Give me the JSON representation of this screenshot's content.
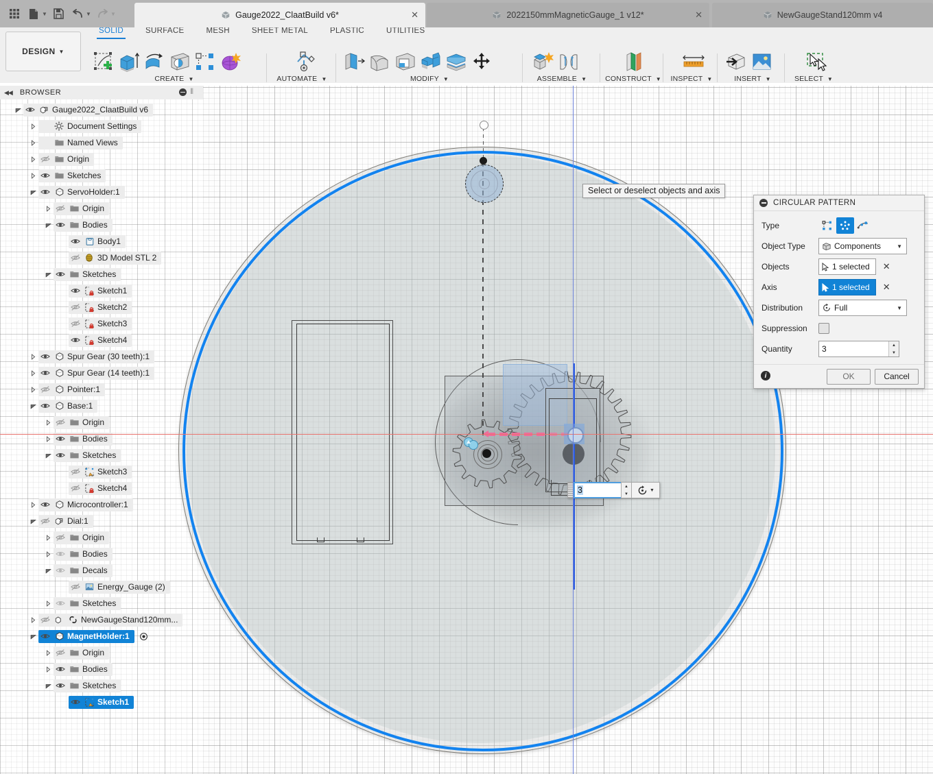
{
  "app": {
    "quick_access": [
      {
        "name": "apps-grid-icon",
        "label": "Apps"
      },
      {
        "name": "new-file-icon",
        "label": "New"
      },
      {
        "name": "save-icon",
        "label": "Save"
      },
      {
        "name": "undo-icon",
        "label": "Undo"
      },
      {
        "name": "redo-icon",
        "label": "Redo"
      }
    ]
  },
  "tabs": [
    {
      "label": "Gauge2022_ClaatBuild v6*",
      "active": true,
      "closable": true
    },
    {
      "label": "2022150mmMagneticGauge_1 v12*",
      "active": false,
      "closable": true
    },
    {
      "label": "NewGaugeStand120mm v4",
      "active": false,
      "closable": false
    }
  ],
  "ribbon": {
    "workspace": "DESIGN",
    "tabs": [
      {
        "label": "SOLID",
        "selected": true
      },
      {
        "label": "SURFACE",
        "selected": false
      },
      {
        "label": "MESH",
        "selected": false
      },
      {
        "label": "SHEET METAL",
        "selected": false
      },
      {
        "label": "PLASTIC",
        "selected": false
      },
      {
        "label": "UTILITIES",
        "selected": false
      }
    ],
    "groups": [
      {
        "label": "CREATE"
      },
      {
        "label": "AUTOMATE"
      },
      {
        "label": "MODIFY"
      },
      {
        "label": "ASSEMBLE"
      },
      {
        "label": "CONSTRUCT"
      },
      {
        "label": "INSPECT"
      },
      {
        "label": "INSERT"
      },
      {
        "label": "SELECT"
      }
    ]
  },
  "browser": {
    "title": "BROWSER",
    "tree": [
      {
        "label": "Gauge2022_ClaatBuild v6",
        "indent": 0,
        "arrow": "down",
        "eye": "on",
        "icon": "component-icon"
      },
      {
        "label": "Document Settings",
        "indent": 1,
        "arrow": "right",
        "eye": "none",
        "icon": "gear-icon"
      },
      {
        "label": "Named Views",
        "indent": 1,
        "arrow": "right",
        "eye": "none",
        "icon": "folder-icon"
      },
      {
        "label": "Origin",
        "indent": 1,
        "arrow": "right",
        "eye": "off",
        "icon": "folder-icon"
      },
      {
        "label": "Sketches",
        "indent": 1,
        "arrow": "right",
        "eye": "on",
        "icon": "folder-icon"
      },
      {
        "label": "ServoHolder:1",
        "indent": 1,
        "arrow": "down",
        "eye": "on",
        "icon": "body-icon"
      },
      {
        "label": "Origin",
        "indent": 2,
        "arrow": "right",
        "eye": "off",
        "icon": "folder-icon"
      },
      {
        "label": "Bodies",
        "indent": 2,
        "arrow": "down",
        "eye": "on",
        "icon": "folder-icon"
      },
      {
        "label": "Body1",
        "indent": 3,
        "arrow": "none",
        "eye": "on",
        "icon": "solid-body-icon"
      },
      {
        "label": "3D Model STL 2",
        "indent": 3,
        "arrow": "none",
        "eye": "off",
        "icon": "mesh-body-icon"
      },
      {
        "label": "Sketches",
        "indent": 2,
        "arrow": "down",
        "eye": "on",
        "icon": "folder-icon"
      },
      {
        "label": "Sketch1",
        "indent": 3,
        "arrow": "none",
        "eye": "on",
        "icon": "sketch-locked-icon"
      },
      {
        "label": "Sketch2",
        "indent": 3,
        "arrow": "none",
        "eye": "off",
        "icon": "sketch-locked-icon"
      },
      {
        "label": "Sketch3",
        "indent": 3,
        "arrow": "none",
        "eye": "off",
        "icon": "sketch-locked-icon"
      },
      {
        "label": "Sketch4",
        "indent": 3,
        "arrow": "none",
        "eye": "on",
        "icon": "sketch-locked-icon"
      },
      {
        "label": "Spur Gear (30 teeth):1",
        "indent": 1,
        "arrow": "right",
        "eye": "on",
        "icon": "body-icon"
      },
      {
        "label": "Spur Gear (14 teeth):1",
        "indent": 1,
        "arrow": "right",
        "eye": "on",
        "icon": "body-icon"
      },
      {
        "label": "Pointer:1",
        "indent": 1,
        "arrow": "right",
        "eye": "off",
        "icon": "body-icon"
      },
      {
        "label": "Base:1",
        "indent": 1,
        "arrow": "down",
        "eye": "on",
        "icon": "body-icon"
      },
      {
        "label": "Origin",
        "indent": 2,
        "arrow": "right",
        "eye": "off",
        "icon": "folder-icon"
      },
      {
        "label": "Bodies",
        "indent": 2,
        "arrow": "right",
        "eye": "on",
        "icon": "folder-icon"
      },
      {
        "label": "Sketches",
        "indent": 2,
        "arrow": "down",
        "eye": "on",
        "icon": "folder-icon"
      },
      {
        "label": "Sketch3",
        "indent": 3,
        "arrow": "none",
        "eye": "off",
        "icon": "sketch-edit-icon"
      },
      {
        "label": "Sketch4",
        "indent": 3,
        "arrow": "none",
        "eye": "off",
        "icon": "sketch-locked-icon"
      },
      {
        "label": "Microcontroller:1",
        "indent": 1,
        "arrow": "right",
        "eye": "on",
        "icon": "body-icon"
      },
      {
        "label": "Dial:1",
        "indent": 1,
        "arrow": "down",
        "eye": "off",
        "icon": "component-icon"
      },
      {
        "label": "Origin",
        "indent": 2,
        "arrow": "right",
        "eye": "off",
        "icon": "folder-icon"
      },
      {
        "label": "Bodies",
        "indent": 2,
        "arrow": "right",
        "eye": "dim",
        "icon": "folder-icon"
      },
      {
        "label": "Decals",
        "indent": 2,
        "arrow": "down",
        "eye": "dim",
        "icon": "folder-icon"
      },
      {
        "label": "Energy_Gauge (2)",
        "indent": 3,
        "arrow": "none",
        "eye": "off",
        "icon": "decal-icon"
      },
      {
        "label": "Sketches",
        "indent": 2,
        "arrow": "right",
        "eye": "dim",
        "icon": "folder-icon"
      },
      {
        "label": "NewGaugeStand120mm...",
        "indent": 1,
        "arrow": "right",
        "eye": "off",
        "icon": "linked-component-icon"
      },
      {
        "label": "MagnetHolder:1",
        "indent": 1,
        "arrow": "down",
        "eye": "on",
        "icon": "body-icon",
        "selected": true,
        "radio": true
      },
      {
        "label": "Origin",
        "indent": 2,
        "arrow": "right",
        "eye": "off",
        "icon": "folder-icon"
      },
      {
        "label": "Bodies",
        "indent": 2,
        "arrow": "right",
        "eye": "on",
        "icon": "folder-icon"
      },
      {
        "label": "Sketches",
        "indent": 2,
        "arrow": "down",
        "eye": "on",
        "icon": "folder-icon"
      },
      {
        "label": "Sketch1",
        "indent": 3,
        "arrow": "none",
        "eye": "on",
        "icon": "sketch-edit-icon",
        "selected": true
      }
    ]
  },
  "canvas": {
    "tooltip": "Select or deselect objects and axis",
    "inline_quantity": {
      "value": "3",
      "type_icon": "circular-pattern-icon"
    },
    "accent_blue": "#1383ef",
    "axis_red": "#e8736e",
    "axis_blue": "#6a7fd8"
  },
  "dialog": {
    "title": "CIRCULAR PATTERN",
    "fields": {
      "type_label": "Type",
      "object_type_label": "Object Type",
      "object_type_value": "Components",
      "objects_label": "Objects",
      "objects_value": "1 selected",
      "axis_label": "Axis",
      "axis_value": "1 selected",
      "distribution_label": "Distribution",
      "distribution_value": "Full",
      "suppression_label": "Suppression",
      "quantity_label": "Quantity",
      "quantity_value": "3"
    },
    "buttons": {
      "ok": "OK",
      "cancel": "Cancel"
    },
    "selected_color": "#1183d6"
  }
}
